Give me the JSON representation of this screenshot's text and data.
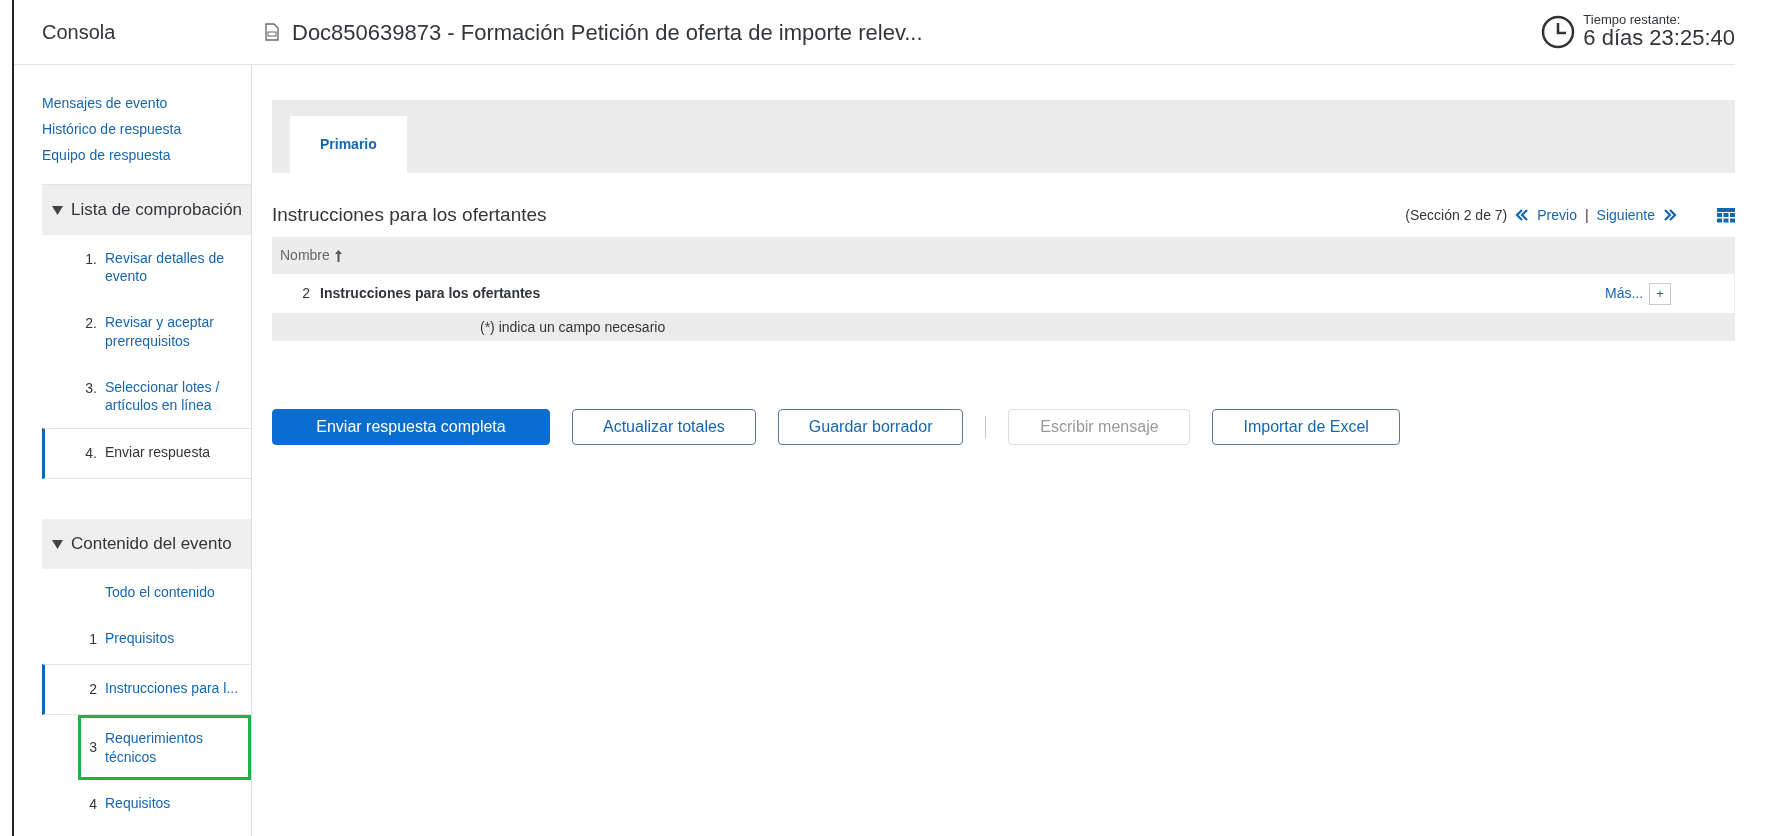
{
  "header": {
    "console_label": "Consola",
    "doc_title": "Doc850639873 - Formación Petición de oferta de importe relev...",
    "time_label": "Tiempo restante:",
    "time_value": "6 días 23:25:40"
  },
  "sidebar": {
    "links": [
      "Mensajes de evento",
      "Histórico de respuesta",
      "Equipo de respuesta"
    ],
    "sections": [
      {
        "title": "Lista de comprobación",
        "expanded": true,
        "items": [
          {
            "number": "1.",
            "label": "Revisar detalles de evento",
            "link": true,
            "selected": false,
            "highlighted": false
          },
          {
            "number": "2.",
            "label": "Revisar y aceptar prerrequisitos",
            "link": true,
            "selected": false,
            "highlighted": false
          },
          {
            "number": "3.",
            "label": "Seleccionar lotes / artículos en línea",
            "link": true,
            "selected": false,
            "highlighted": false
          },
          {
            "number": "4.",
            "label": "Enviar respuesta",
            "link": false,
            "selected": true,
            "highlighted": false
          }
        ]
      },
      {
        "title": "Contenido del evento",
        "expanded": true,
        "items": [
          {
            "label": "Todo el contenido",
            "link": true,
            "selected": false,
            "highlighted": false
          },
          {
            "number": "1",
            "label": "Prequisitos",
            "link": true,
            "selected": false,
            "highlighted": false
          },
          {
            "number": "2",
            "label": "Instrucciones para l...",
            "link": true,
            "selected": true,
            "highlighted": false
          },
          {
            "number": "3",
            "label": "Requerimientos técnicos",
            "link": true,
            "selected": false,
            "highlighted": true
          },
          {
            "number": "4",
            "label": "Requisitos",
            "link": true,
            "selected": false,
            "highlighted": false
          }
        ]
      }
    ]
  },
  "tabs": [
    {
      "label": "Primario",
      "selected": true
    }
  ],
  "section": {
    "title": "Instrucciones para los ofertantes",
    "position": "(Sección 2 de 7)",
    "prev": "Previo",
    "separator": "|",
    "next": "Siguiente"
  },
  "table": {
    "columns": [
      {
        "label": "Nombre",
        "sorted": true
      }
    ],
    "rows": [
      {
        "number": "2",
        "name": "Instrucciones para los ofertantes",
        "more": "Más...",
        "expand": "+"
      }
    ],
    "footer": "(*) indica un campo necesario"
  },
  "buttons": [
    {
      "label": "Enviar respuesta completa",
      "kind": "primary",
      "disabled": false
    },
    {
      "label": "Actualizar totales",
      "kind": "secondary",
      "disabled": false
    },
    {
      "label": "Guardar borrador",
      "kind": "secondary",
      "disabled": false
    },
    {
      "label": "Escribir mensaje",
      "kind": "secondary",
      "disabled": true
    },
    {
      "label": "Importar de Excel",
      "kind": "secondary",
      "disabled": false
    }
  ]
}
